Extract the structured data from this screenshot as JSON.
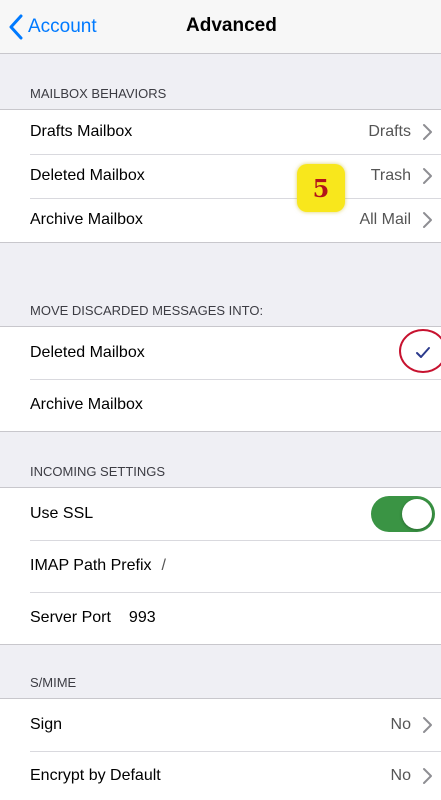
{
  "navbar": {
    "back_label": "Account",
    "title": "Advanced",
    "accent_color": "#007aff"
  },
  "sections": [
    {
      "header": "MAILBOX BEHAVIORS",
      "rows": [
        {
          "label": "Drafts Mailbox",
          "value": "Drafts"
        },
        {
          "label": "Deleted Mailbox",
          "value": "Trash"
        },
        {
          "label": "Archive Mailbox",
          "value": "All Mail"
        }
      ]
    },
    {
      "header": "MOVE DISCARDED MESSAGES INTO:",
      "rows": [
        {
          "label": "Deleted Mailbox",
          "selected": true
        },
        {
          "label": "Archive Mailbox",
          "selected": false
        }
      ]
    },
    {
      "header": "INCOMING SETTINGS",
      "rows": [
        {
          "label": "Use SSL",
          "toggle_on": true
        },
        {
          "label": "IMAP Path Prefix",
          "value": "/"
        },
        {
          "label": "Server Port",
          "value": "993"
        }
      ]
    },
    {
      "header": "S/MIME",
      "rows": [
        {
          "label": "Sign",
          "value": "No"
        },
        {
          "label": "Encrypt by Default",
          "value": "No"
        }
      ]
    }
  ],
  "annotation": {
    "step_number": "5",
    "badge_color": "#f8e71c",
    "circle_color": "#c7122f"
  },
  "colors": {
    "toggle_on": "#3a9444",
    "checkmark": "#2b3a8c"
  },
  "icons": {
    "back": "chevron-left-icon",
    "disclosure": "chevron-right-icon",
    "selected": "checkmark-icon"
  }
}
